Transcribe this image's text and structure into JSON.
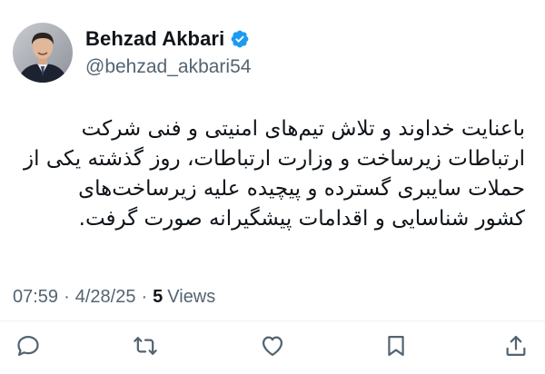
{
  "author": {
    "display_name": "Behzad Akbari",
    "handle": "@behzad_akbari54",
    "verified_icon": "verified-badge-icon",
    "verified_color": "#1d9bf0"
  },
  "tweet": {
    "lines": [
      "باعنایت خداوند و تلاش تیم‌های امنیتی و فنی شرکت",
      "ارتباطات زیرساخت و وزارت ارتباطات، روز گذشته یکی از",
      "حملات سایبری گسترده و پیچیده علیه زیرساخت‌های",
      "کشور شناسایی و اقدامات پیشگیرانه صورت گرفت."
    ]
  },
  "meta": {
    "time": "07:59",
    "separator": "·",
    "date": "4/28/25",
    "views_count": "5",
    "views_label": "Views"
  },
  "actions": [
    {
      "icon": "reply-icon"
    },
    {
      "icon": "retweet-icon"
    },
    {
      "icon": "like-icon"
    },
    {
      "icon": "bookmark-icon"
    },
    {
      "icon": "share-icon"
    }
  ],
  "colors": {
    "text": "#0f1419",
    "secondary": "#536471",
    "accent": "#1d9bf0"
  }
}
